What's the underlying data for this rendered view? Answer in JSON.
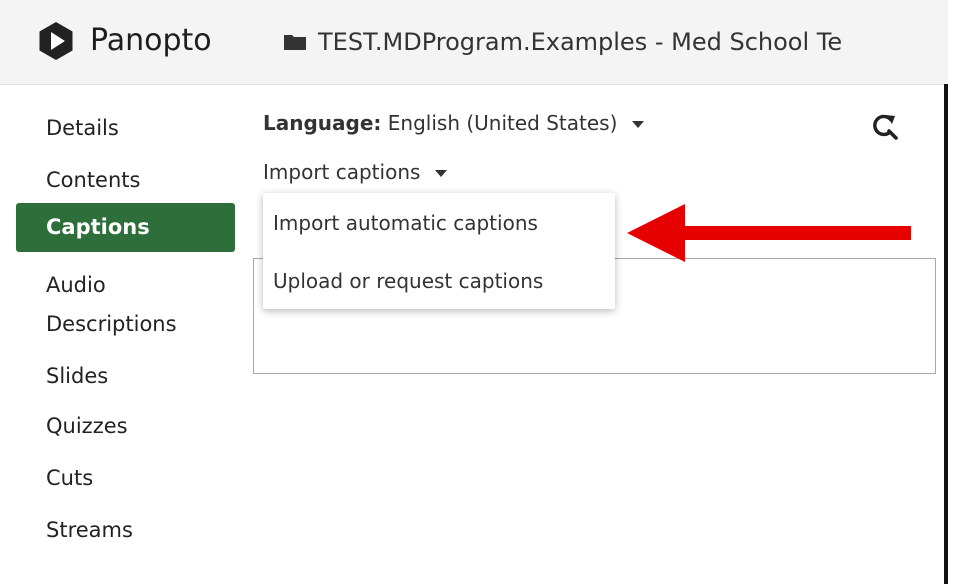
{
  "header": {
    "app_name": "Panopto",
    "logo_icon": "panopto-logo-icon",
    "folder_icon": "folder-icon",
    "folder_path": "TEST.MDProgram.Examples - Med School Te"
  },
  "sidebar": {
    "items": [
      {
        "label": "Details",
        "active": false
      },
      {
        "label": "Contents",
        "active": false
      },
      {
        "label": "Captions",
        "active": true
      },
      {
        "label": "Audio",
        "active": false
      },
      {
        "label": "Descriptions",
        "active": false
      },
      {
        "label": "Slides",
        "active": false
      },
      {
        "label": "Quizzes",
        "active": false
      },
      {
        "label": "Cuts",
        "active": false
      },
      {
        "label": "Streams",
        "active": false
      }
    ]
  },
  "main": {
    "language_label": "Language:",
    "language_value": "English (United States)",
    "refresh_icon": "refresh-search-icon",
    "import_label": "Import captions",
    "import_menu": [
      "Import automatic captions",
      "Upload or request captions"
    ]
  },
  "colors": {
    "active_nav_bg": "#2d6e3a",
    "header_bg": "#f4f4f4",
    "annotation_arrow": "#e60000"
  }
}
